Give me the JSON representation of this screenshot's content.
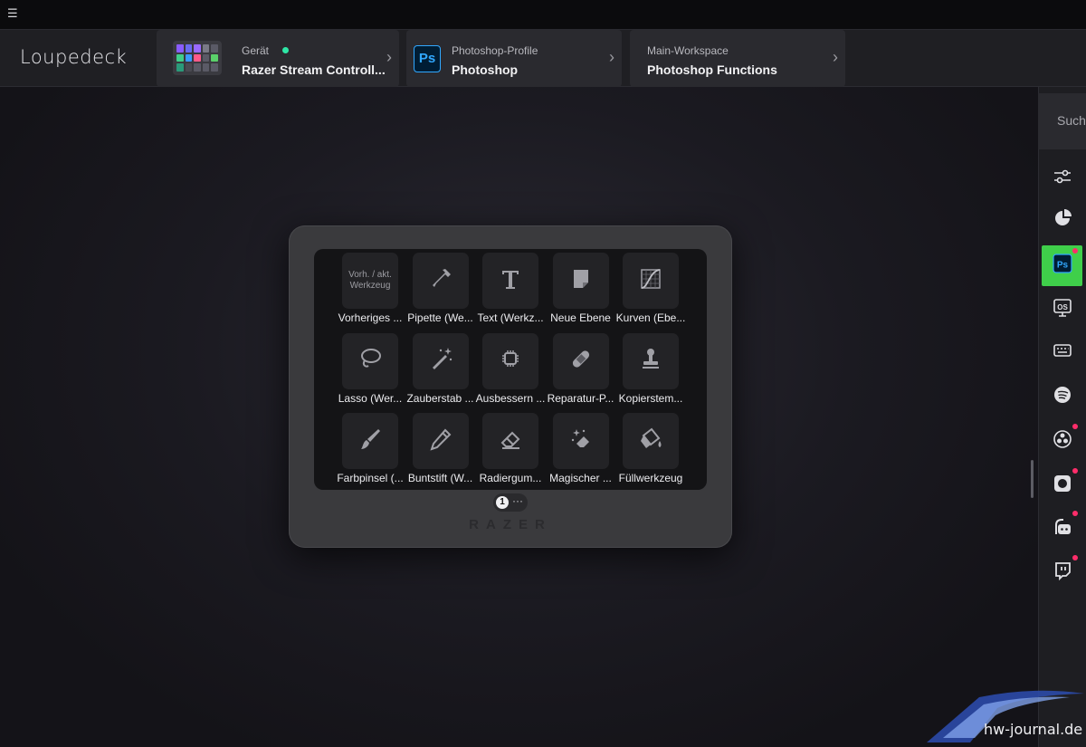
{
  "app": {
    "menu_icon": "hamburger-icon",
    "logo": "Loupedeck"
  },
  "header": {
    "device": {
      "label": "Gerät",
      "value": "Razer Stream Controll...",
      "status_color": "#2ee6a6"
    },
    "profile": {
      "label": "Photoshop-Profile",
      "value": "Photoshop",
      "badge": "Ps"
    },
    "workspace": {
      "label": "Main-Workspace",
      "value": "Photoshop Functions"
    }
  },
  "device_keys": [
    {
      "label": "Vorheriges ...",
      "icon": "text",
      "icon_text": "Vorh. / akt. Werkzeug"
    },
    {
      "label": "Pipette (We...",
      "icon": "eyedropper-icon"
    },
    {
      "label": "Text (Werkz...",
      "icon": "text-tool-icon"
    },
    {
      "label": "Neue Ebene",
      "icon": "new-layer-icon"
    },
    {
      "label": "Kurven (Ebe...",
      "icon": "curves-icon"
    },
    {
      "label": "Lasso (Wer...",
      "icon": "lasso-icon"
    },
    {
      "label": "Zauberstab ...",
      "icon": "magic-wand-icon"
    },
    {
      "label": "Ausbessern ...",
      "icon": "patch-icon"
    },
    {
      "label": "Reparatur-P...",
      "icon": "bandage-icon"
    },
    {
      "label": "Kopierstem...",
      "icon": "stamp-icon"
    },
    {
      "label": "Farbpinsel (...",
      "icon": "brush-icon"
    },
    {
      "label": "Buntstift (W...",
      "icon": "pencil-icon"
    },
    {
      "label": "Radiergum...",
      "icon": "eraser-icon"
    },
    {
      "label": "Magischer ...",
      "icon": "magic-eraser-icon"
    },
    {
      "label": "Füllwerkzeug",
      "icon": "paint-bucket-icon"
    }
  ],
  "pager": {
    "page": "1",
    "more": "···"
  },
  "brand": "RAZER",
  "sidebar": {
    "search_placeholder": "Suche",
    "items": [
      {
        "name": "sliders-icon",
        "active": false,
        "badge": false
      },
      {
        "name": "pie-icon",
        "active": false,
        "badge": false
      },
      {
        "name": "photoshop-icon",
        "active": true,
        "badge": true,
        "text": "Ps"
      },
      {
        "name": "os-icon",
        "active": false,
        "badge": false,
        "text": "OS"
      },
      {
        "name": "keyboard-icon",
        "active": false,
        "badge": false
      },
      {
        "name": "spotify-icon",
        "active": false,
        "badge": false
      },
      {
        "name": "obs-icon",
        "active": false,
        "badge": true
      },
      {
        "name": "camera-icon",
        "active": false,
        "badge": true
      },
      {
        "name": "streamlabs-icon",
        "active": false,
        "badge": true
      },
      {
        "name": "twitch-icon",
        "active": false,
        "badge": true
      }
    ]
  },
  "watermark": "hw-journal.de",
  "colors": {
    "accent_green": "#3fcf4a",
    "badge_red": "#ff2d6a",
    "ps_blue": "#31a8ff"
  }
}
